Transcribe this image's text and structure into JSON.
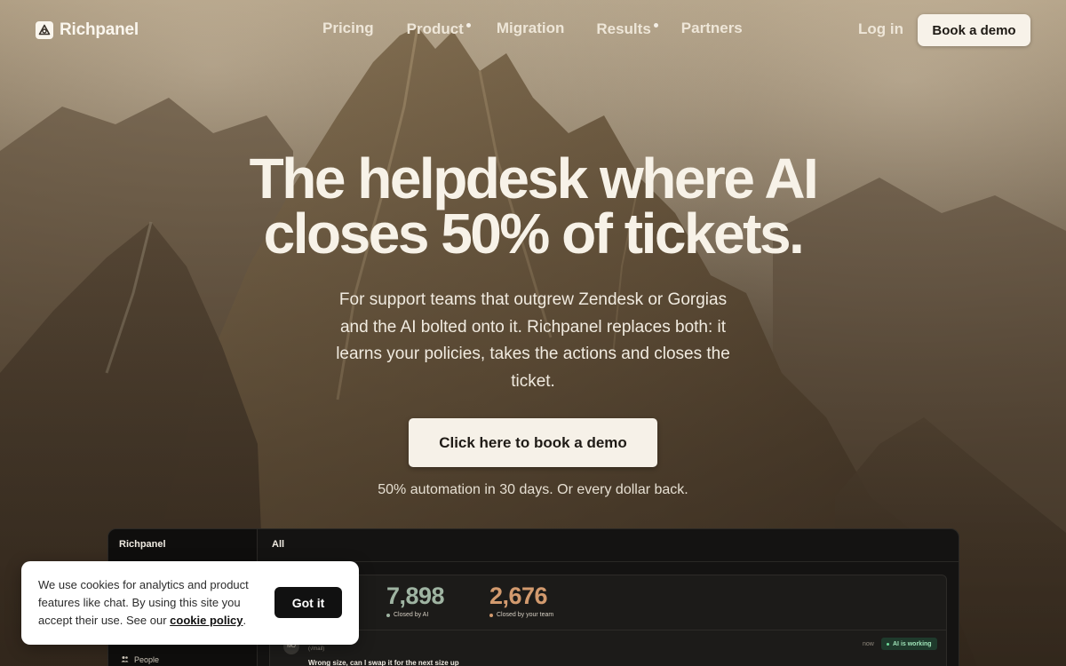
{
  "nav": {
    "brand": "Richpanel",
    "links": [
      {
        "label": "Pricing",
        "has_dot": false
      },
      {
        "label": "Product",
        "has_dot": true
      },
      {
        "label": "Migration",
        "has_dot": false
      },
      {
        "label": "Results",
        "has_dot": true
      },
      {
        "label": "Partners",
        "has_dot": false
      }
    ],
    "login": "Log in",
    "cta": "Book a demo"
  },
  "hero": {
    "title_line1": "The helpdesk where AI",
    "title_line2": "closes 50% of tickets.",
    "subtitle": "For support teams that outgrew Zendesk or Gorgias and the AI bolted onto it. Richpanel replaces both: it learns your policies, takes the actions and closes the ticket.",
    "cta": "Click here to book a demo",
    "guarantee": "50% automation in 30 days. Or every dollar back."
  },
  "app_preview": {
    "brand": "Richpanel",
    "tab": "All",
    "sidebar_item": "People",
    "stats": [
      {
        "value": "7,898",
        "label": "Closed by AI",
        "color": "#9fb4a2"
      },
      {
        "value": "2,676",
        "label": "Closed by your team",
        "color": "#d29a6e"
      }
    ],
    "ticket": {
      "avatar": "MO",
      "meta": "(√mail)",
      "subject": "Wrong size, can I swap it for the next size up",
      "time": "now",
      "badge": "AI is working"
    }
  },
  "cookie": {
    "text_before": "We use cookies for analytics and product features like chat. By using this site you accept their use. See our ",
    "link": "cookie policy",
    "text_after": ".",
    "button": "Got it"
  },
  "colors": {
    "cream": "#f7f2e9",
    "dark": "#111111",
    "ai_green": "#9fe3b8"
  }
}
